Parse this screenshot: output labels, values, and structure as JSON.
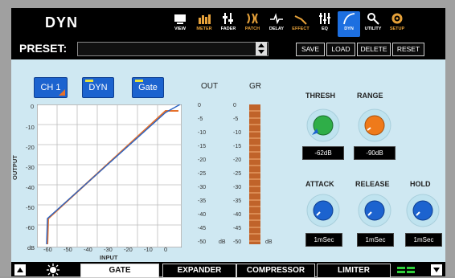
{
  "header": {
    "title": "DYN"
  },
  "toolbar": [
    {
      "label": "VIEW",
      "icon": "view-icon",
      "state": "white"
    },
    {
      "label": "METER",
      "icon": "meter-icon",
      "state": "orange"
    },
    {
      "label": "FADER",
      "icon": "fader-icon",
      "state": "white"
    },
    {
      "label": "PATCH",
      "icon": "patch-icon",
      "state": "orange"
    },
    {
      "label": "DELAY",
      "icon": "delay-icon",
      "state": "white"
    },
    {
      "label": "EFFECT",
      "icon": "effect-icon",
      "state": "orange"
    },
    {
      "label": "EQ",
      "icon": "eq-icon",
      "state": "white"
    },
    {
      "label": "DYN",
      "icon": "dyn-icon",
      "state": "active"
    },
    {
      "label": "UTILITY",
      "icon": "utility-icon",
      "state": "white"
    },
    {
      "label": "SETUP",
      "icon": "setup-icon",
      "state": "orange"
    }
  ],
  "preset": {
    "label": "PRESET:",
    "value": "",
    "buttons": [
      "SAVE",
      "LOAD",
      "DELETE",
      "RESET"
    ]
  },
  "channel": {
    "ch_label": "CH 1",
    "dyn_label": "DYN",
    "gate_label": "Gate"
  },
  "graph": {
    "ylabel": "OUTPUT",
    "xlabel": "INPUT",
    "y_ticks": [
      "0",
      "-10",
      "-20",
      "-30",
      "-40",
      "-50",
      "-60",
      "dB"
    ],
    "x_ticks": [
      "-60",
      "-50",
      "-40",
      "-30",
      "-20",
      "-10",
      "0"
    ]
  },
  "meters": {
    "out_label": "OUT",
    "gr_label": "GR",
    "ticks": [
      "0",
      "-5",
      "-10",
      "-15",
      "-20",
      "-25",
      "-30",
      "-35",
      "-40",
      "-45",
      "-50"
    ],
    "unit": "dB"
  },
  "controls": {
    "thresh": {
      "label": "THRESH",
      "value": "-62dB"
    },
    "range": {
      "label": "RANGE",
      "value": "-90dB"
    },
    "attack": {
      "label": "ATTACK",
      "value": "1mSec"
    },
    "release": {
      "label": "RELEASE",
      "value": "1mSec"
    },
    "hold": {
      "label": "HOLD",
      "value": "1mSec"
    }
  },
  "tabs": {
    "gate": "GATE",
    "expander": "EXPANDER",
    "compressor": "COMPRESSOR",
    "limiter": "LIMITER"
  },
  "colors": {
    "accent": "#1c63cf",
    "graph_line_orange": "#e6702a",
    "graph_line_blue": "#2a64c4",
    "gr_meter": "#e07a2a"
  }
}
